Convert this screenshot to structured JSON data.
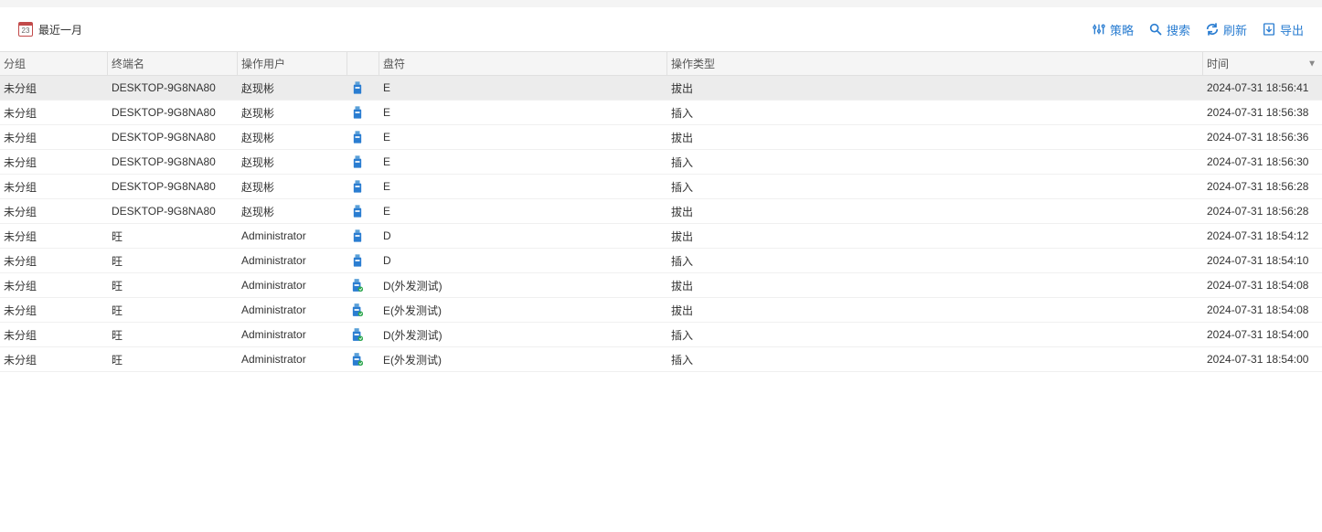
{
  "toolbar": {
    "date_range": "最近一月",
    "calendar_day": "23",
    "actions": {
      "policy": "策略",
      "search": "搜索",
      "refresh": "刷新",
      "export": "导出"
    }
  },
  "columns": {
    "group": "分组",
    "terminal": "终端名",
    "user": "操作用户",
    "icon": "",
    "drive": "盘符",
    "optype": "操作类型",
    "time": "时间"
  },
  "rows": [
    {
      "group": "未分组",
      "terminal": "DESKTOP-9G8NA80",
      "user": "赵现彬",
      "icon_type": "usb",
      "drive": "E",
      "optype": "拔出",
      "time": "2024-07-31 18:56:41",
      "selected": true
    },
    {
      "group": "未分组",
      "terminal": "DESKTOP-9G8NA80",
      "user": "赵现彬",
      "icon_type": "usb",
      "drive": "E",
      "optype": "插入",
      "time": "2024-07-31 18:56:38"
    },
    {
      "group": "未分组",
      "terminal": "DESKTOP-9G8NA80",
      "user": "赵现彬",
      "icon_type": "usb",
      "drive": "E",
      "optype": "拔出",
      "time": "2024-07-31 18:56:36"
    },
    {
      "group": "未分组",
      "terminal": "DESKTOP-9G8NA80",
      "user": "赵现彬",
      "icon_type": "usb",
      "drive": "E",
      "optype": "插入",
      "time": "2024-07-31 18:56:30"
    },
    {
      "group": "未分组",
      "terminal": "DESKTOP-9G8NA80",
      "user": "赵现彬",
      "icon_type": "usb",
      "drive": "E",
      "optype": "插入",
      "time": "2024-07-31 18:56:28"
    },
    {
      "group": "未分组",
      "terminal": "DESKTOP-9G8NA80",
      "user": "赵现彬",
      "icon_type": "usb",
      "drive": "E",
      "optype": "拔出",
      "time": "2024-07-31 18:56:28"
    },
    {
      "group": "未分组",
      "terminal": "旺",
      "user": "Administrator",
      "icon_type": "usb",
      "drive": "D",
      "optype": "拔出",
      "time": "2024-07-31 18:54:12"
    },
    {
      "group": "未分组",
      "terminal": "旺",
      "user": "Administrator",
      "icon_type": "usb",
      "drive": "D",
      "optype": "插入",
      "time": "2024-07-31 18:54:10"
    },
    {
      "group": "未分组",
      "terminal": "旺",
      "user": "Administrator",
      "icon_type": "usb-sec",
      "drive": "D(外发测试)",
      "optype": "拔出",
      "time": "2024-07-31 18:54:08"
    },
    {
      "group": "未分组",
      "terminal": "旺",
      "user": "Administrator",
      "icon_type": "usb-sec",
      "drive": "E(外发测试)",
      "optype": "拔出",
      "time": "2024-07-31 18:54:08"
    },
    {
      "group": "未分组",
      "terminal": "旺",
      "user": "Administrator",
      "icon_type": "usb-sec",
      "drive": "D(外发测试)",
      "optype": "插入",
      "time": "2024-07-31 18:54:00"
    },
    {
      "group": "未分组",
      "terminal": "旺",
      "user": "Administrator",
      "icon_type": "usb-sec",
      "drive": "E(外发测试)",
      "optype": "插入",
      "time": "2024-07-31 18:54:00"
    }
  ]
}
